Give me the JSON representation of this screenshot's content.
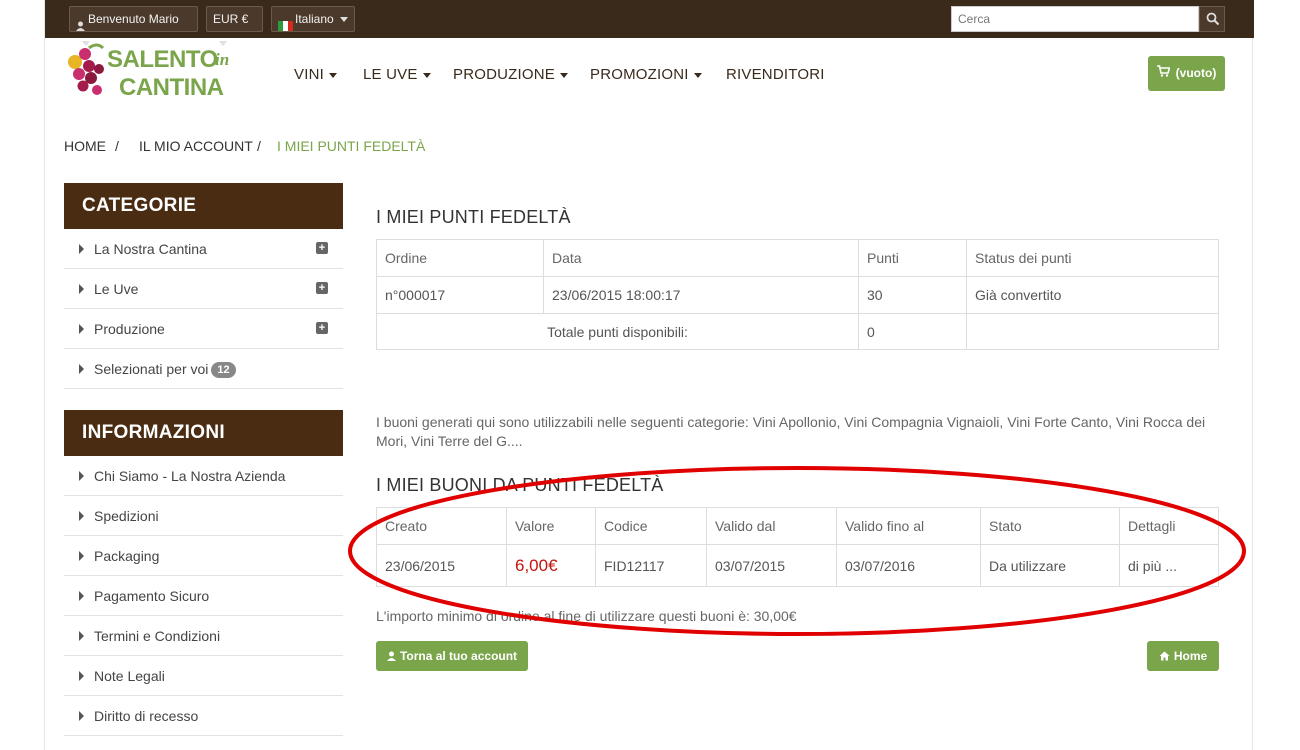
{
  "topbar": {
    "user_label": "Benvenuto Mario",
    "currency_label": "EUR €",
    "language_label": "Italiano",
    "search_placeholder": "Cerca"
  },
  "logo": {
    "line1": "SALENTO",
    "line2": "CANTINA",
    "script": "in"
  },
  "nav": {
    "items": [
      "VINI",
      "LE UVE",
      "PRODUZIONE",
      "PROMOZIONI",
      "RIVENDITORI"
    ]
  },
  "cart": {
    "label": "(vuoto)"
  },
  "breadcrumb": {
    "items": [
      "HOME",
      "IL MIO ACCOUNT",
      "I MIEI PUNTI FEDELTÀ"
    ],
    "separator": "/"
  },
  "sidebar": {
    "categorie_title": "CATEGORIE",
    "categorie": [
      {
        "label": "La Nostra Cantina"
      },
      {
        "label": "Le Uve"
      },
      {
        "label": "Produzione"
      },
      {
        "label": "Selezionati per voi",
        "badge": "12"
      }
    ],
    "informazioni_title": "INFORMAZIONI",
    "informazioni": [
      {
        "label": "Chi Siamo - La Nostra Azienda"
      },
      {
        "label": "Spedizioni"
      },
      {
        "label": "Packaging"
      },
      {
        "label": "Pagamento Sicuro"
      },
      {
        "label": "Termini e Condizioni"
      },
      {
        "label": "Note Legali"
      },
      {
        "label": "Diritto di recesso"
      }
    ]
  },
  "points": {
    "title": "I MIEI PUNTI FEDELTÀ",
    "headers": [
      "Ordine",
      "Data",
      "Punti",
      "Status dei punti"
    ],
    "row": [
      "n°000017",
      "23/06/2015 18:00:17",
      "30",
      "Già convertito"
    ],
    "total_label": "Totale punti disponibili:",
    "total_value": "0"
  },
  "categories_note": "I buoni generati qui sono utilizzabili nelle seguenti categorie: Vini Apollonio, Vini Compagnia Vignaioli, Vini Forte Canto, Vini Rocca dei Mori, Vini Terre del G....",
  "vouchers": {
    "title": "I MIEI BUONI DA PUNTI FEDELTÀ",
    "headers": [
      "Creato",
      "Valore",
      "Codice",
      "Valido dal",
      "Valido fino al",
      "Stato",
      "Dettagli"
    ],
    "row": [
      "23/06/2015",
      "6,00€",
      "FID12117",
      "03/07/2015",
      "03/07/2016",
      "Da utilizzare",
      "di più ..."
    ],
    "value_color": "#c0150e"
  },
  "min_order_note": "L'importo minimo di ordine al fine di utilizzare questi buoni è: 30,00€",
  "buttons": {
    "back_account": "Torna al tuo account",
    "home": "Home"
  },
  "colors": {
    "topbar": "#3a2a1c",
    "sidebar_header": "#4a2c12",
    "accent_green": "#7aa54a",
    "annotation_red": "#e00000"
  }
}
